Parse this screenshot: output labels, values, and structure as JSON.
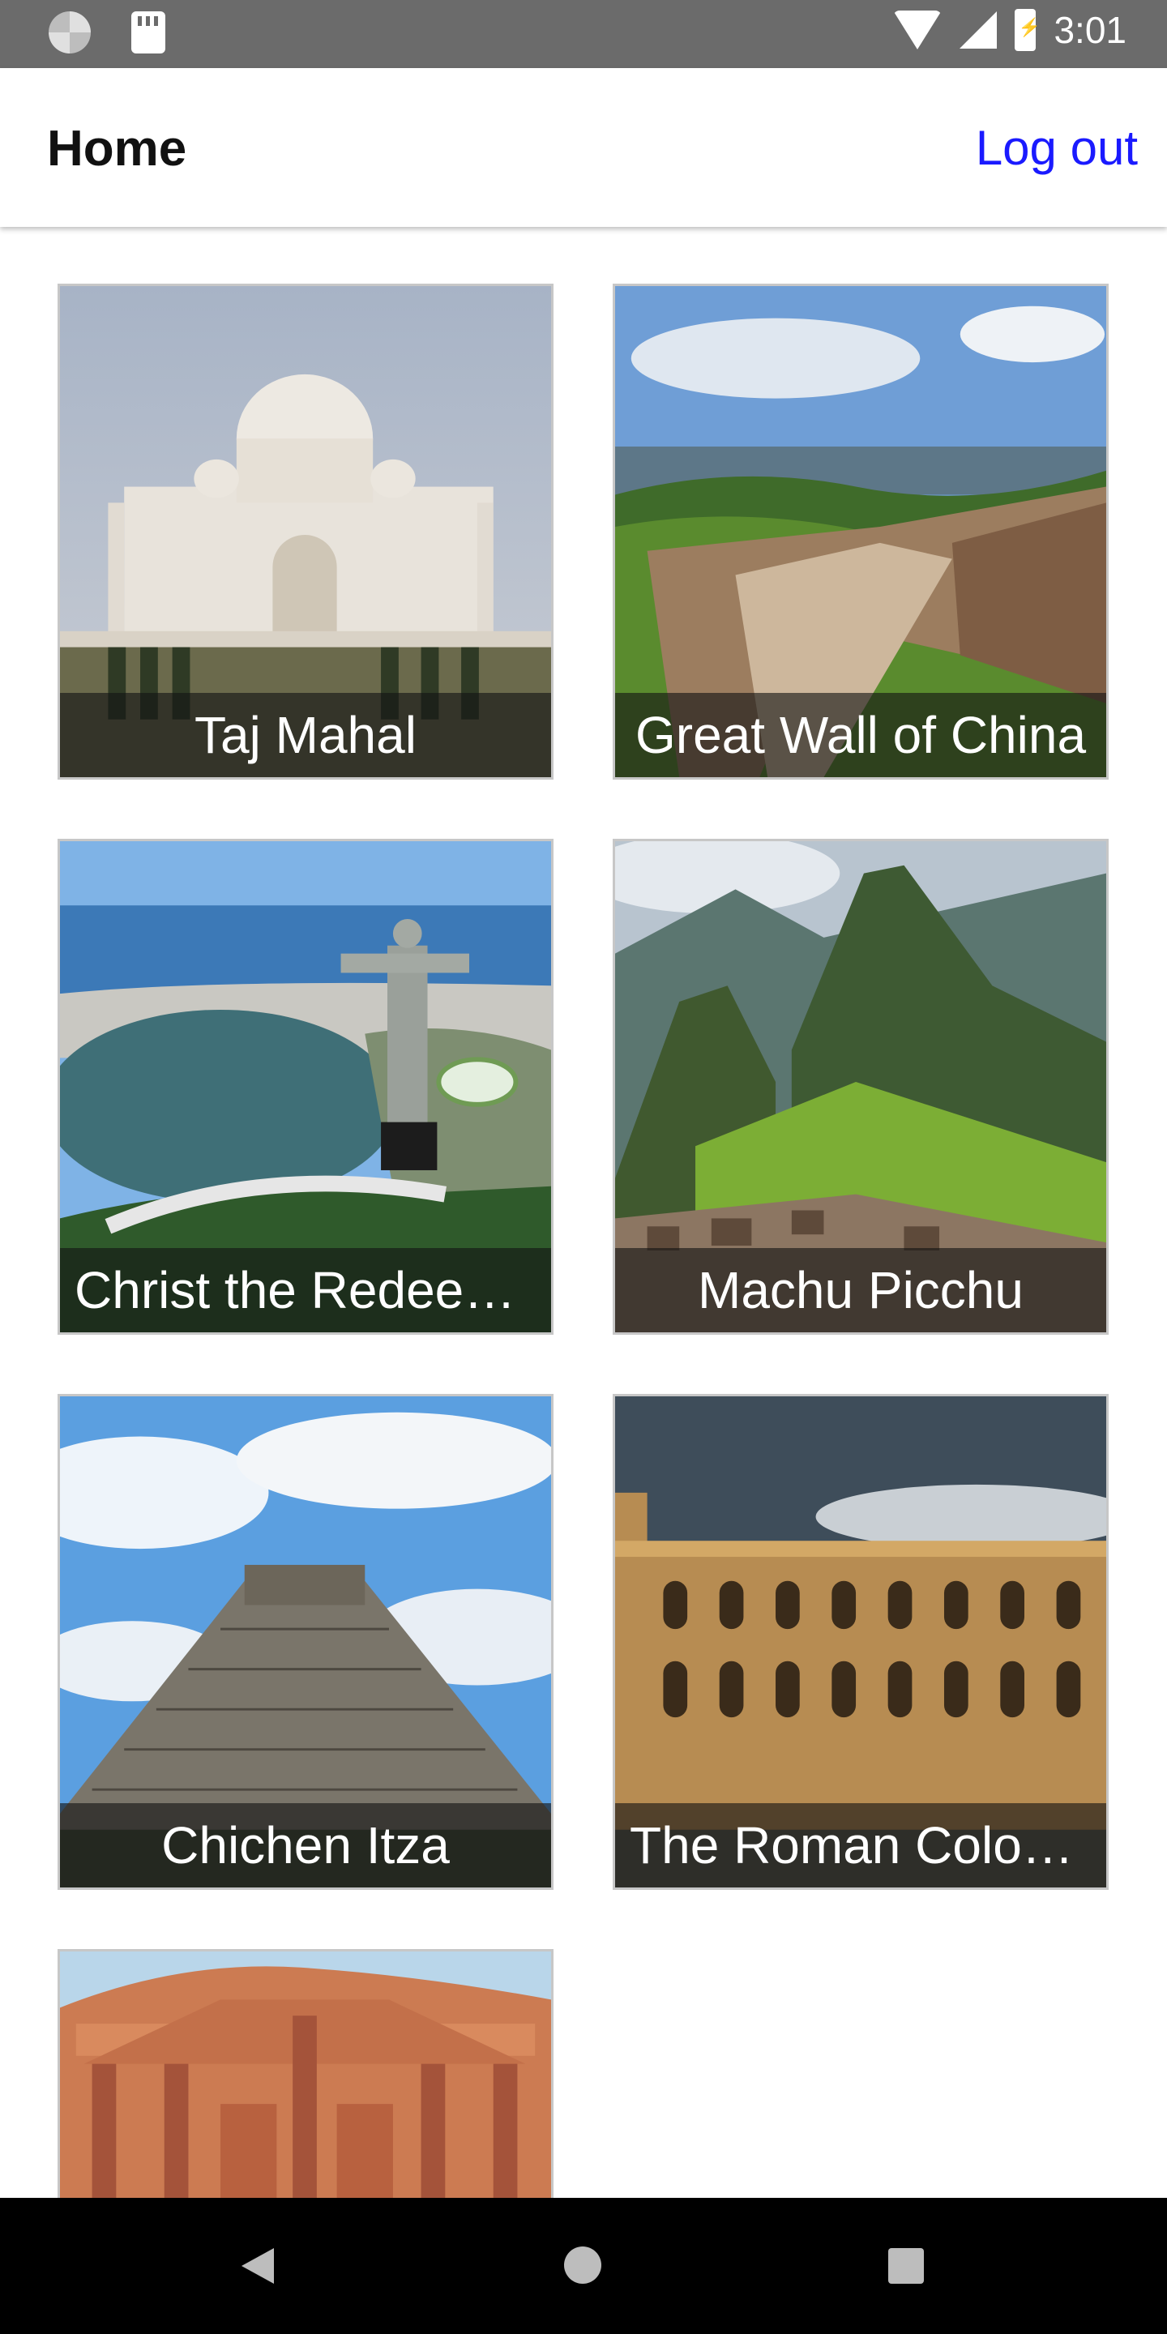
{
  "status_bar": {
    "time": "3:01"
  },
  "header": {
    "title": "Home",
    "logout_label": "Log out"
  },
  "wonders": [
    {
      "caption": "Taj Mahal"
    },
    {
      "caption": "Great Wall of China"
    },
    {
      "caption": "Christ the Redeemer"
    },
    {
      "caption": "Machu Picchu"
    },
    {
      "caption": "Chichen Itza"
    },
    {
      "caption": "The Roman Colosseum"
    },
    {
      "caption": ""
    }
  ],
  "colors": {
    "link": "#1a1aff",
    "status_bar": "#6b6b6b",
    "nav_bar": "#000000"
  }
}
